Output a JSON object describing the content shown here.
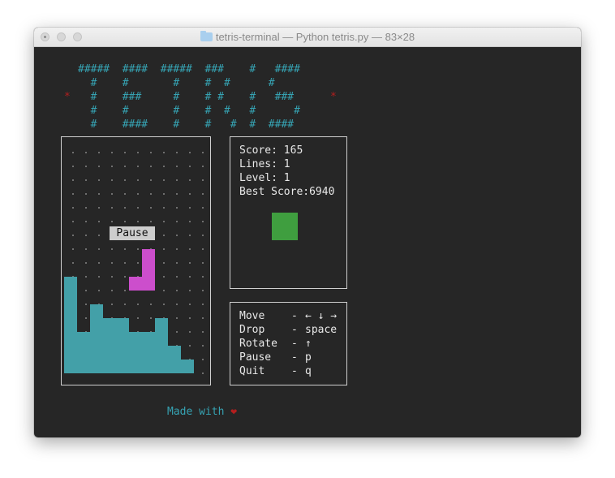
{
  "window": {
    "title": "tetris-terminal — Python tetris.py — 83×28"
  },
  "logo": {
    "lines": [
      "#####  ####  #####  ###    #   ####",
      "  #    #       #    #  #      #",
      "  #    ###     #    # #    #   ###",
      "  #    #       #    #  #   #      #",
      "  #    ####    #    #   #  #  ####"
    ],
    "star_glyph": "*"
  },
  "board": {
    "pause_label": "Pause"
  },
  "stats": {
    "score": "Score: 165",
    "lines": "Lines: 1",
    "level": "Level: 1",
    "best": "Best Score:6940"
  },
  "controls": [
    {
      "key": "Move",
      "dash": "-",
      "value": "← ↓ →"
    },
    {
      "key": "Drop",
      "dash": "-",
      "value": "space"
    },
    {
      "key": "Rotate",
      "dash": "-",
      "value": "↑"
    },
    {
      "key": "Pause",
      "dash": "-",
      "value": "p"
    },
    {
      "key": "Quit",
      "dash": "-",
      "value": "q"
    }
  ],
  "footer": {
    "made_with": "Made with ",
    "heart": "❤"
  },
  "colors": {
    "stack": "#43a0a8",
    "falling_piece": "#cc4ecc",
    "next_piece": "#3f9e3f",
    "logo": "#36a3b3",
    "accent_red": "#b41e1e"
  }
}
